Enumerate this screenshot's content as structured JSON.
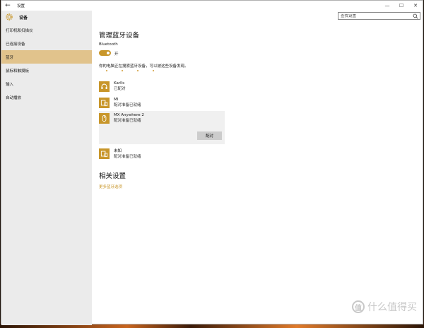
{
  "window": {
    "title": "设置",
    "back_glyph": "←",
    "minimize": "—",
    "maximize": "☐",
    "close": "✕"
  },
  "sidebar": {
    "header": "设备",
    "items": [
      {
        "label": "打印机和扫描仪",
        "active": false
      },
      {
        "label": "已连接设备",
        "active": false
      },
      {
        "label": "蓝牙",
        "active": true
      },
      {
        "label": "鼠标和触摸板",
        "active": false
      },
      {
        "label": "输入",
        "active": false
      },
      {
        "label": "自动播放",
        "active": false
      }
    ]
  },
  "search": {
    "placeholder": "查找设置"
  },
  "main": {
    "title": "管理蓝牙设备",
    "bluetooth_label": "Bluetooth",
    "toggle_state": "开",
    "search_status": "你的电脑正在搜索蓝牙设备，可以被这些设备发现。",
    "devices": [
      {
        "name": "Karlls",
        "status": "已配对",
        "icon": "headset-icon"
      },
      {
        "name": "MI",
        "status": "配对准备已就绪",
        "icon": "devices-icon"
      },
      {
        "name": "MX Anywhere 2",
        "status": "配对准备已就绪",
        "icon": "mouse-icon",
        "pair_label": "配对"
      },
      {
        "name": "未知",
        "status": "配对准备已就绪",
        "icon": "devices-icon"
      }
    ],
    "related_title": "相关设置",
    "more_link": "更多蓝牙选项"
  },
  "watermark": {
    "text": "什么值得买",
    "glyph": "值"
  },
  "colors": {
    "accent": "#c8962a",
    "active_nav": "#e1c38c",
    "sidebar_bg": "#ebebeb"
  }
}
